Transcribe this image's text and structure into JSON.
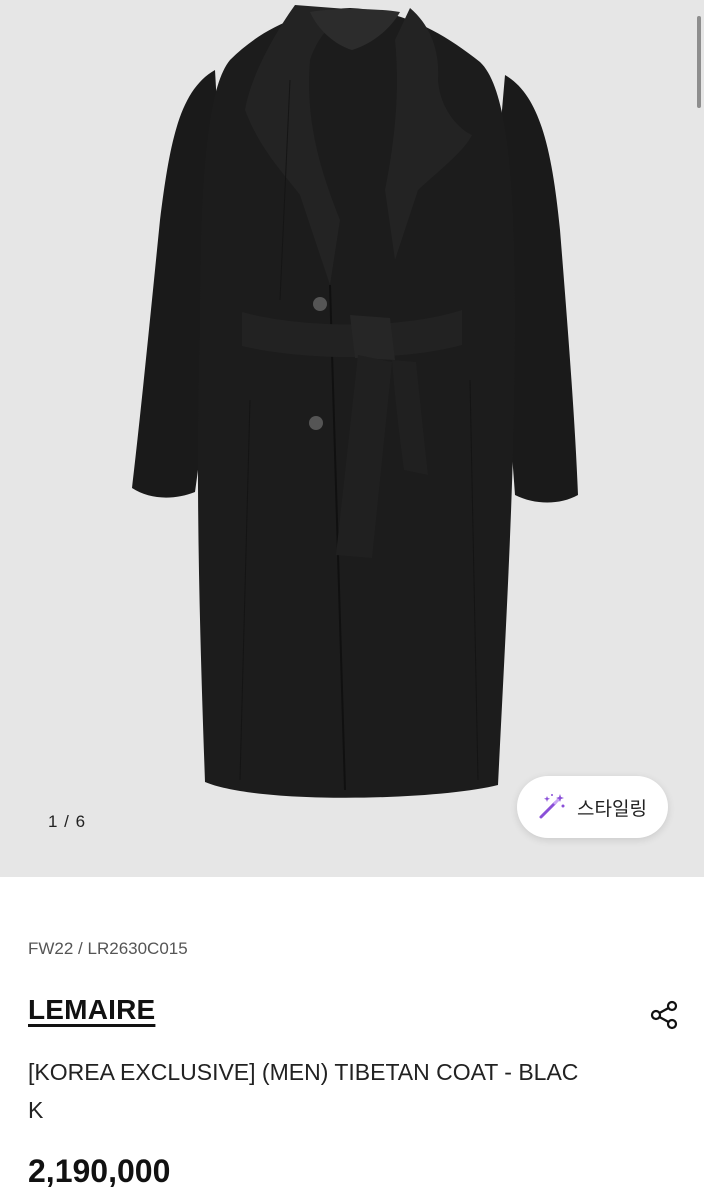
{
  "gallery": {
    "counter": "1 / 6",
    "styling_label": "스타일링",
    "image_subject": "black wool shawl-collar belted coat"
  },
  "product": {
    "season_code": "FW22 / LR2630C015",
    "brand": "LEMAIRE",
    "name": "[KOREA EXCLUSIVE] (MEN) TIBETAN COAT - BLACK",
    "price": "2,190,000"
  },
  "colors": {
    "gallery_bg": "#e6e6e6",
    "coat": "#1b1b1b",
    "accent_wand": "#8a4fd8"
  },
  "icons": [
    "magic-wand-icon",
    "share-icon"
  ]
}
